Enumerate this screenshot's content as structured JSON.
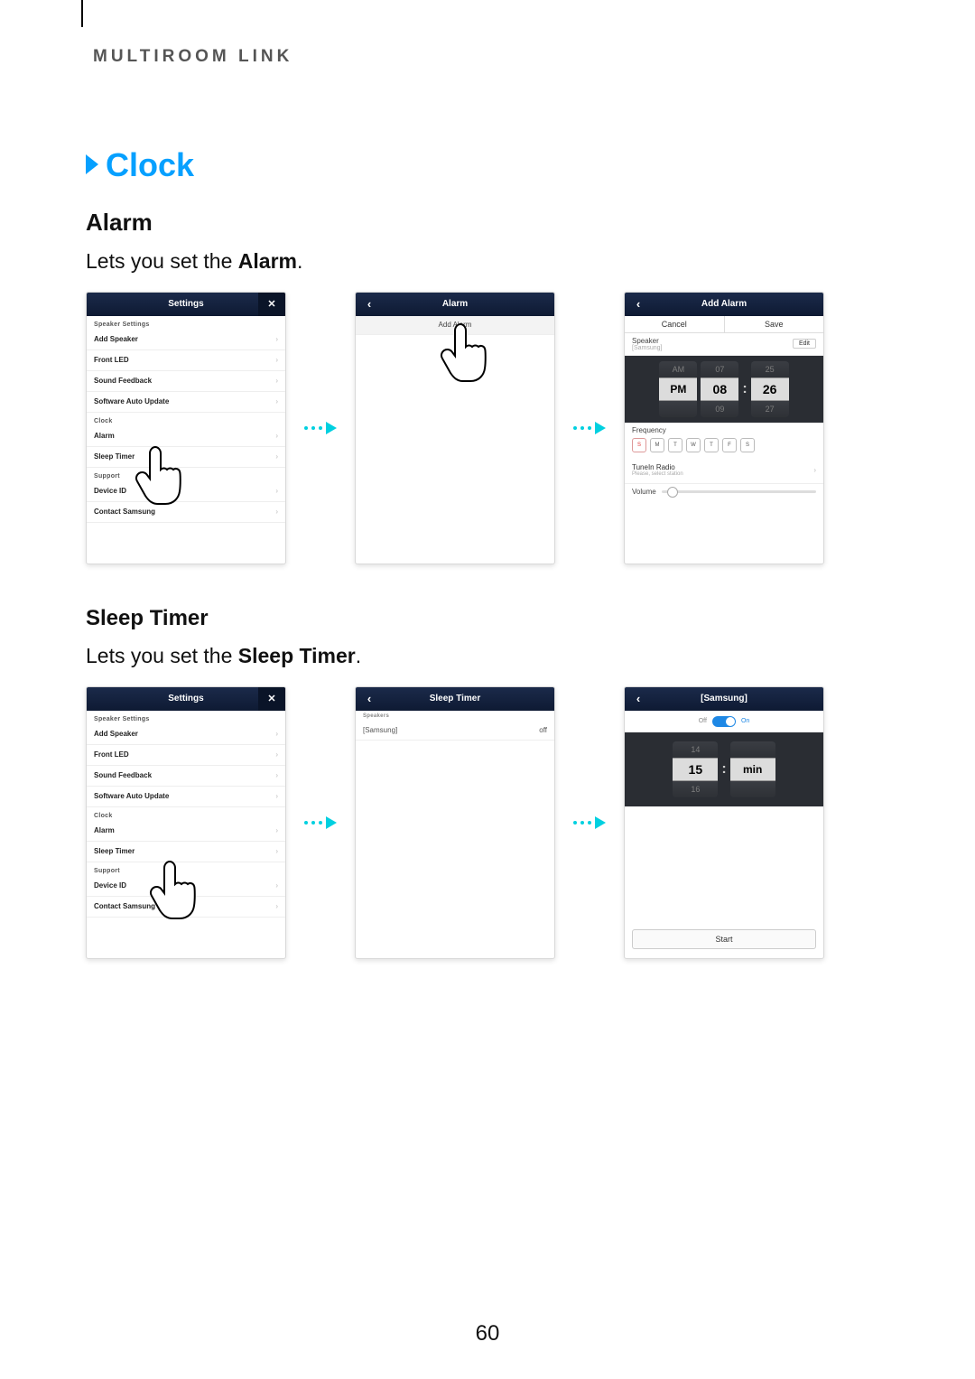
{
  "breadcrumb": "MULTIROOM LINK",
  "section_title": "Clock",
  "alarm": {
    "heading": "Alarm",
    "desc_prefix": "Lets you set the ",
    "desc_bold": "Alarm",
    "desc_suffix": "."
  },
  "sleep": {
    "heading": "Sleep Timer",
    "desc_prefix": "Lets you set the ",
    "desc_bold": "Sleep Timer",
    "desc_suffix": "."
  },
  "settings_panel": {
    "title": "Settings",
    "cat_speaker": "Speaker Settings",
    "cat_clock": "Clock",
    "cat_support": "Support",
    "items": {
      "add_speaker": "Add Speaker",
      "front_led": "Front LED",
      "sound_feedback": "Sound Feedback",
      "software_auto_update": "Software Auto Update",
      "alarm": "Alarm",
      "sleep_timer": "Sleep Timer",
      "device_id": "Device ID",
      "contact_samsung": "Contact Samsung"
    }
  },
  "alarm_list": {
    "title": "Alarm",
    "add_alarm": "Add Alarm"
  },
  "add_alarm": {
    "title": "Add Alarm",
    "cancel": "Cancel",
    "save": "Save",
    "speaker_label": "Speaker",
    "speaker_value": "[Samsung]",
    "edit": "Edit",
    "ampm_up": "AM",
    "ampm_sel": "PM",
    "h_up": "07",
    "h_sel": "08",
    "h_dn": "09",
    "m_up": "25",
    "m_sel": "26",
    "m_dn": "27",
    "frequency": "Frequency",
    "days": [
      "S",
      "M",
      "T",
      "W",
      "T",
      "F",
      "S"
    ],
    "tunein": "TuneIn Radio",
    "tunein_sub": "Please, select station",
    "volume": "Volume"
  },
  "sleep_list": {
    "title": "Sleep Timer",
    "speakers_cat": "Speakers",
    "item_name": "[Samsung]",
    "item_status": "off"
  },
  "sleep_detail": {
    "title": "[Samsung]",
    "off": "Off",
    "on": "On",
    "min_up": "14",
    "min_sel": "15",
    "unit": "min",
    "min_dn": "16",
    "start": "Start"
  },
  "page_number": "60"
}
